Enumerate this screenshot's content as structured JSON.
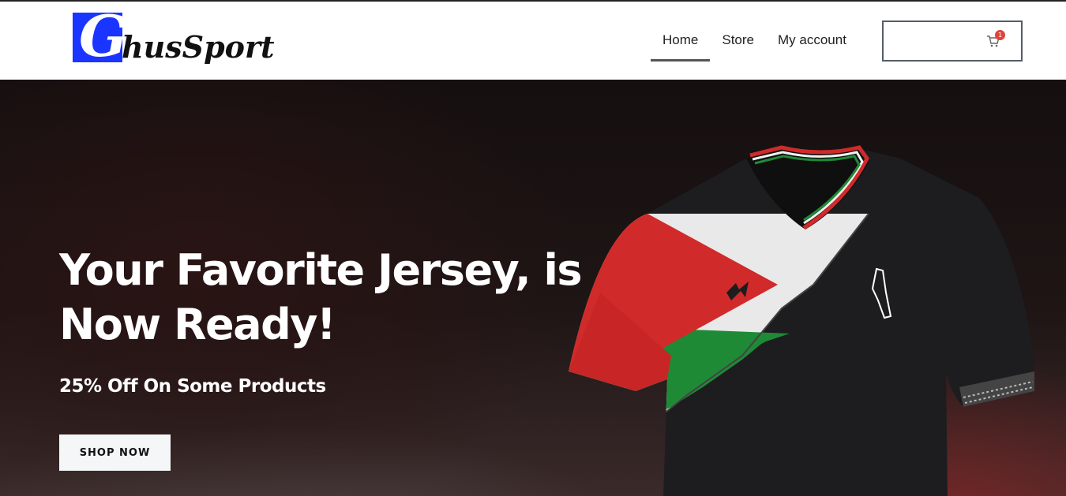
{
  "logo": {
    "letter": "G",
    "rest": "husSport"
  },
  "nav": {
    "items": [
      {
        "label": "Home"
      },
      {
        "label": "Store"
      },
      {
        "label": "My account"
      }
    ]
  },
  "cart": {
    "count": "1",
    "icon": "cart-icon"
  },
  "hero": {
    "title": "Your Favorite Jersey, is Now Ready!",
    "subtitle": "25% Off On Some Products",
    "button": "SHOP NOW",
    "image": "palestine-flag-jersey"
  },
  "colors": {
    "logo_blue": "#1a35ff",
    "badge_red": "#e0453b",
    "flag_red": "#d12a2a",
    "flag_green": "#1f8a36"
  }
}
